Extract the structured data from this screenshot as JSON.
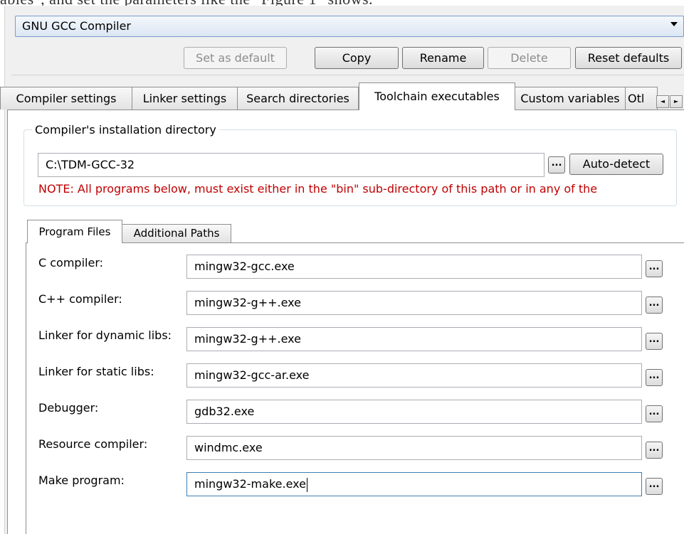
{
  "document": {
    "cropped_text": "ables\", and set the parameters like the \"Figure 1\" shows."
  },
  "compiler": {
    "selected": "GNU GCC Compiler"
  },
  "toolbar": {
    "set_default": "Set as default",
    "copy": "Copy",
    "rename": "Rename",
    "delete": "Delete",
    "reset_defaults": "Reset defaults"
  },
  "tabs": [
    {
      "label": "Compiler settings"
    },
    {
      "label": "Linker settings"
    },
    {
      "label": "Search directories"
    },
    {
      "label": "Toolchain executables"
    },
    {
      "label": "Custom variables"
    },
    {
      "label": "Otl"
    }
  ],
  "tab_scroll": {
    "left": "◄",
    "right": "►"
  },
  "install": {
    "group_label": "Compiler's installation directory",
    "path": "C:\\TDM-GCC-32",
    "browse": "...",
    "auto_detect": "Auto-detect",
    "note": "NOTE: All programs below, must exist either in the \"bin\" sub-directory of this path or in any of the"
  },
  "inner_tabs": [
    {
      "label": "Program Files"
    },
    {
      "label": "Additional Paths"
    }
  ],
  "programs": [
    {
      "label": "C compiler:",
      "value": "mingw32-gcc.exe"
    },
    {
      "label": "C++ compiler:",
      "value": "mingw32-g++.exe"
    },
    {
      "label": "Linker for dynamic libs:",
      "value": "mingw32-g++.exe"
    },
    {
      "label": "Linker for static libs:",
      "value": "mingw32-gcc-ar.exe"
    },
    {
      "label": "Debugger:",
      "value": "gdb32.exe"
    },
    {
      "label": "Resource compiler:",
      "value": "windmc.exe"
    },
    {
      "label": "Make program:",
      "value": "mingw32-make.exe"
    }
  ],
  "browse_label": "..."
}
